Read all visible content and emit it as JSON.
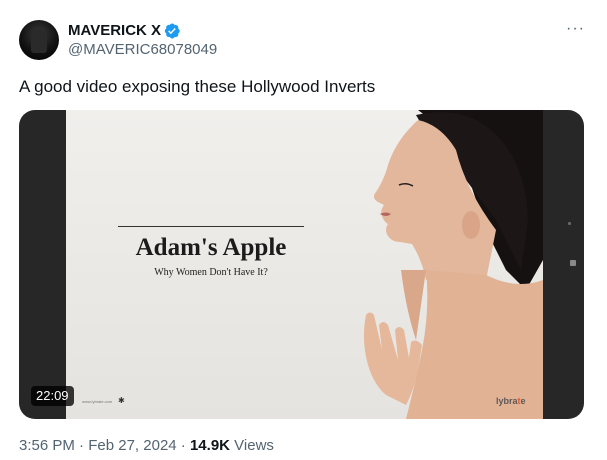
{
  "author": {
    "display_name": "MAVERICK X",
    "handle": "@MAVERIC68078049",
    "verified": true
  },
  "tweet": {
    "text": "A good video exposing these Hollywood Inverts"
  },
  "video": {
    "title": "Adam's Apple",
    "subtitle": "Why Women Don't Have It?",
    "website": "www.lybrate.com",
    "logo_prefix": "lybra",
    "logo_accent": "t",
    "logo_suffix": "e",
    "duration": "22:09"
  },
  "meta": {
    "time": "3:56 PM",
    "separator": "·",
    "date": "Feb 27, 2024",
    "views_count": "14.9K",
    "views_label": "Views"
  },
  "icons": {
    "verified": "verified-badge-icon",
    "more": "more-options-icon"
  },
  "colors": {
    "verified_blue": "#1d9bf0",
    "secondary_text": "#536471",
    "primary_text": "#0f1419",
    "logo_accent": "#e05b2a"
  }
}
